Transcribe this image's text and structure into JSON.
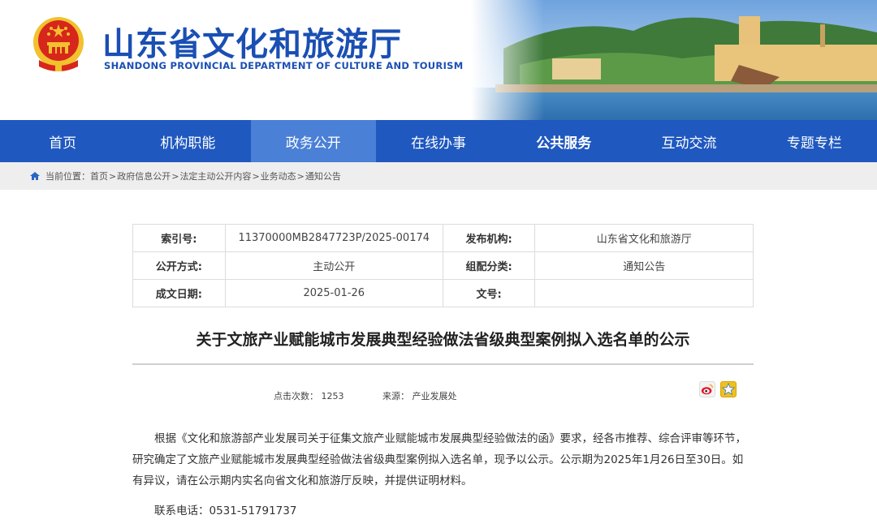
{
  "header": {
    "title": "山东省文化和旅游厅",
    "subtitle": "SHANDONG PROVINCIAL DEPARTMENT OF CULTURE AND  TOURISM",
    "emblem_icon": "national-emblem-icon",
    "colors": {
      "brand_blue": "#1a4fb3",
      "emblem_red": "#d7261c",
      "emblem_gold": "#f2c12e"
    }
  },
  "nav": {
    "items": [
      {
        "label": "首页"
      },
      {
        "label": "机构职能"
      },
      {
        "label": "政务公开"
      },
      {
        "label": "在线办事"
      },
      {
        "label": "公共服务"
      },
      {
        "label": "互动交流"
      },
      {
        "label": "专题专栏"
      }
    ],
    "active": "政务公开",
    "colors": {
      "bar": "#1f58bf",
      "active": "#4a80d6"
    }
  },
  "breadcrumb": {
    "prefix": "当前位置：",
    "items": [
      "首页",
      "政府信息公开",
      "法定主动公开内容",
      "业务动态",
      "通知公告"
    ],
    "separator": ">"
  },
  "meta": {
    "index_label": "索引号:",
    "index_value": "11370000MB2847723P/2025-00174",
    "publisher_label": "发布机构:",
    "publisher_value": "山东省文化和旅游厅",
    "open_label": "公开方式:",
    "open_value": "主动公开",
    "category_label": "组配分类:",
    "category_value": "通知公告",
    "date_label": "成文日期:",
    "date_value": "2025-01-26",
    "docno_label": "文号:",
    "docno_value": ""
  },
  "article": {
    "title": "关于文旅产业赋能城市发展典型经验做法省级典型案例拟入选名单的公示",
    "views_label": "点击次数：",
    "views_value": "1253",
    "source_label": "来源：",
    "source_value": "产业发展处",
    "body": "根据《文化和旅游部产业发展司关于征集文旅产业赋能城市发展典型经验做法的函》要求，经各市推荐、综合评审等环节，研究确定了文旅产业赋能城市发展典型经验做法省级典型案例拟入选名单，现予以公示。公示期为2025年1月26日至30日。如有异议，请在公示期内实名向省文化和旅游厅反映，并提供证明材料。",
    "contact": "联系电话：0531-51791737"
  },
  "share": {
    "icons": [
      "weibo-icon",
      "qzone-icon"
    ]
  }
}
